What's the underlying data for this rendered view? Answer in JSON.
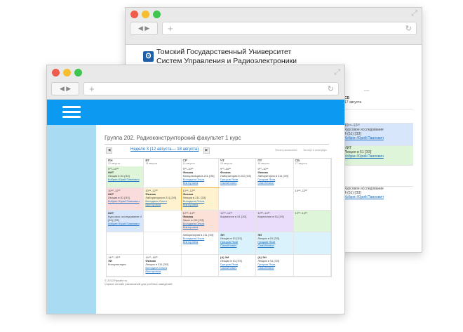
{
  "back_window": {
    "university_line1": "Томский Государственный Университет",
    "university_line2": "Систем Управления и Радиоэлектроники",
    "column": {
      "day": "СБ",
      "date": "17 августа",
      "cells": [
        {
          "time": "",
          "lines": [],
          "bg": "#ffffff"
        },
        {
          "time": "10⁴⁵–12²⁰",
          "lines": [
            "Курсовое исследование",
            "4 (51) [ЭЗ]"
          ],
          "link": "Кобрин Юрий Павлович",
          "bg": "#d7e6fb"
        },
        {
          "time": "",
          "lines": [
            "ИИТ",
            "Лекция в 51 [ЭЗ]"
          ],
          "link": "Кобрин Юрий Павлович",
          "bg": "#dff5d9"
        },
        {
          "time": "",
          "lines": [],
          "bg": "#ffffff"
        },
        {
          "time": "",
          "lines": [
            "Курсовое исследование",
            "4 (51) [ЭЗ]"
          ],
          "link": "Кобрин Юрий Павлович",
          "bg": "#ffffff"
        }
      ]
    }
  },
  "front_window": {
    "group_title": "Группа 202. Радиоконструкторский факультет 1 курс",
    "week_label": "Неделя 3 (12 августа— 18 августа)",
    "toolbar_tiny": [
      "Печать расписания",
      "Экспорт в календарь"
    ],
    "days": [
      {
        "abbr": "ПН",
        "date": "12 августа"
      },
      {
        "abbr": "ВТ",
        "date": "13 августа"
      },
      {
        "abbr": "СР",
        "date": "14 августа"
      },
      {
        "abbr": "ЧТ",
        "date": "15 августа"
      },
      {
        "abbr": "ПТ",
        "date": "16 августа"
      },
      {
        "abbr": "СБ",
        "date": "17 августа"
      }
    ],
    "rows": [
      [
        {
          "time": "9⁰⁰–10³⁵",
          "title": "ИИТ",
          "text": "Лекция в 51 [ЭЗ]",
          "link": "Кобрин Юрий Павлович",
          "bg": "#dff5d9"
        },
        {
          "time": "",
          "title": "",
          "text": "",
          "link": "",
          "bg": "#ffffff"
        },
        {
          "time": "9⁰⁰–10³⁵",
          "title": "Физика",
          "text": "Консультация в 211 [ЭЗ]",
          "link": "Володина Ольга Викторовна",
          "bg": "#ffffff"
        },
        {
          "time": "9⁰⁰–10³⁵",
          "title": "Физика",
          "text": "Лаборатория в 211 [ЭЗ]",
          "link": "Грицков Яков Самойлович",
          "bg": "#ffffff"
        },
        {
          "time": "9⁰⁰–10³⁵",
          "title": "Физика",
          "text": "Лаборатория в 211 [ЭЗ]",
          "link": "Грицков Яков Самойлович",
          "bg": "#ffffff"
        },
        {
          "time": "",
          "title": "",
          "text": "",
          "link": "",
          "bg": "#ffffff"
        }
      ],
      [
        {
          "time": "10⁴⁵–12²⁰",
          "title": "ИИТ",
          "text": "Лекция в 51 [ЭЗ]",
          "link": "Кобрин Юрий Павлович",
          "bg": "#fbdcdc"
        },
        {
          "time": "10⁴⁵–12²⁰",
          "title": "Физика",
          "text": "Лаборатория в 211 [ЭЗ]",
          "link": "Володина Ольга Викторовна",
          "bg": "#fff3cf"
        },
        {
          "time": "10⁴⁵–12²⁰",
          "title": "Физика",
          "text": "Лекция в 211 [ЭЗ]",
          "link": "Володина Ольга Викторовна",
          "bg": "#fff3cf"
        },
        {
          "time": "",
          "title": "",
          "text": "",
          "link": "",
          "bg": "#ffffff"
        },
        {
          "time": "",
          "title": "",
          "text": "",
          "link": "",
          "bg": "#ffffff"
        },
        {
          "time": "10⁴⁵–12²⁰",
          "title": "",
          "text": "",
          "link": "",
          "bg": "#ffffff"
        }
      ],
      [
        {
          "time": "",
          "title": "ИИТ",
          "text": "Курсовое исследование 4 (51) [ЭЗ]",
          "link": "Кобрин Юрий Павлович",
          "bg": "#d7e6fb"
        },
        {
          "time": "",
          "title": "",
          "text": "",
          "link": "",
          "bg": "#ffffff"
        },
        {
          "time": "12⁵⁰–14²⁵",
          "title": "Физика",
          "text": "Зачет в 211 [ЭЗ]",
          "link": "Володина Ольга Викторовна",
          "bg": "#fbe1d8"
        },
        {
          "time": "12⁵⁰–14²⁵",
          "title": "",
          "text": "Кирпичное в 51 [ЭЗ]",
          "link": "",
          "bg": "#e9ddfb"
        },
        {
          "time": "12⁵⁰–14²⁵",
          "title": "",
          "text": "Кирпичное в 51 [ЭЗ]",
          "link": "",
          "bg": "#e9ddfb"
        },
        {
          "time": "12⁵⁰–14²⁵",
          "title": "",
          "text": "",
          "link": "",
          "bg": "#dff5d9"
        }
      ],
      [
        {
          "time": "",
          "title": "",
          "text": "",
          "link": "",
          "bg": "#ffffff"
        },
        {
          "time": "",
          "title": "",
          "text": "",
          "link": "",
          "bg": "#ffffff"
        },
        {
          "time": "",
          "title": "",
          "text": "Лаборатория в 211 [ЭЗ]",
          "link": "Володина Ольга Викторовна",
          "bg": "#ffffff"
        },
        {
          "time": "",
          "title": "ЭИ",
          "text": "Лекция в 51 [ЭЗ]",
          "link": "Грицков Яков Самойлович",
          "bg": "#d9f2fb"
        },
        {
          "time": "",
          "title": "ЭИ",
          "text": "Лекция в 51 [ЭЗ]",
          "link": "Грицков Яков Самойлович",
          "bg": "#d9f2fb"
        },
        {
          "time": "",
          "title": "",
          "text": "",
          "link": "",
          "bg": "#d9f2fb"
        }
      ],
      [
        {
          "time": "14⁴⁰–16¹⁵",
          "title": "ЭИ",
          "text": "Консультация",
          "link": "",
          "bg": "#ffffff"
        },
        {
          "time": "14⁴⁰–16¹⁵",
          "title": "Физика",
          "text": "Лекция в 211 [ЭЗ]",
          "link": "Володина Ольга Викторовна",
          "bg": "#ffffff"
        },
        {
          "time": "",
          "title": "",
          "text": "",
          "link": "",
          "bg": "#ffffff"
        },
        {
          "time": "",
          "title": "(А) ЭИ",
          "text": "Лекция в 51 [ЭЗ]",
          "link": "Грицков Яков Самойлович",
          "bg": "#ffffff"
        },
        {
          "time": "",
          "title": "(А) ЭИ",
          "text": "Лекция в 51 [ЭЗ]",
          "link": "Грицков Яков Самойлович",
          "bg": "#ffffff"
        },
        {
          "time": "",
          "title": "",
          "text": "",
          "link": "",
          "bg": "#ffffff"
        }
      ]
    ],
    "footer_line1": "© 2013 Rpsaite.ru",
    "footer_line2": "Сервис онлайн расписаний для учебных заведений"
  },
  "colors": {
    "accent_blue": "#0b99f1",
    "sidebar": "#a9dbf3"
  },
  "icons": [
    "back-arrow-icon",
    "forward-arrow-icon",
    "plus-icon",
    "reload-icon",
    "expand-icon",
    "menu-icon",
    "logo-icon"
  ]
}
